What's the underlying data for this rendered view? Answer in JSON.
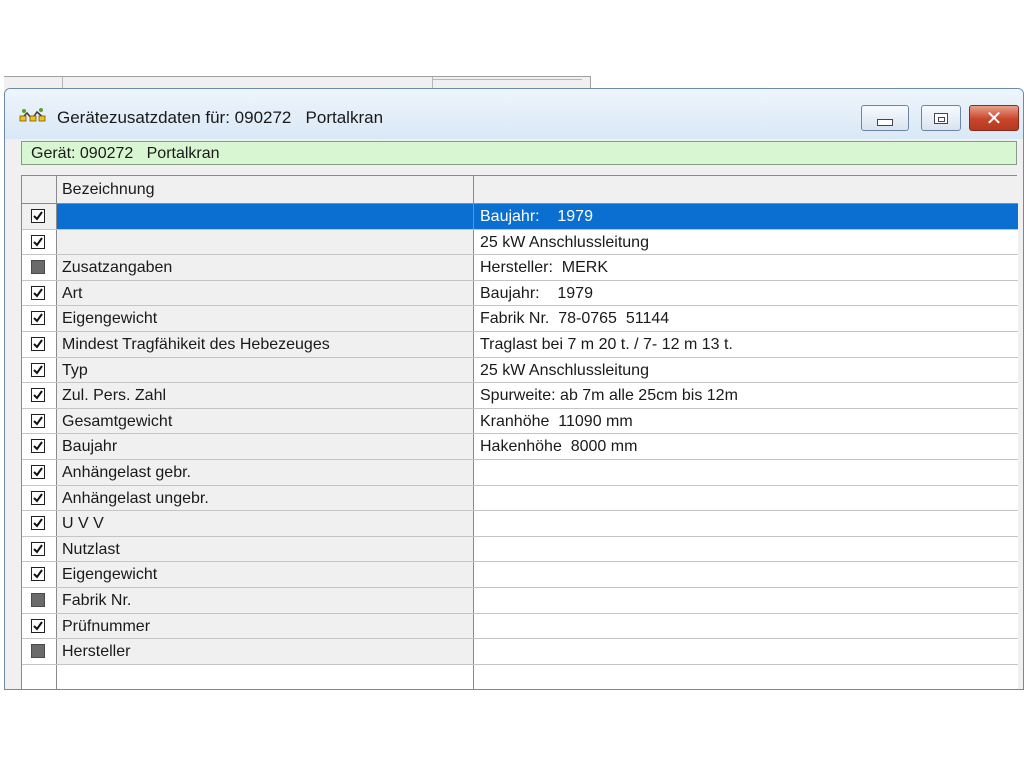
{
  "window": {
    "title": "Gerätezusatzdaten für: 090272   Portalkran",
    "device_label": "Gerät: 090272   Portalkran"
  },
  "grid": {
    "header": {
      "label": "Bezeichnung",
      "value": ""
    },
    "rows": [
      {
        "state": "checked",
        "label": "",
        "value": "Baujahr:    1979",
        "selected": true
      },
      {
        "state": "checked",
        "label": "",
        "value": "25 kW Anschlussleitung"
      },
      {
        "state": "indeterminate",
        "label": "Zusatzangaben",
        "value": "Hersteller:  MERK"
      },
      {
        "state": "checked",
        "label": "Art",
        "value": "Baujahr:    1979"
      },
      {
        "state": "checked",
        "label": "Eigengewicht",
        "value": "Fabrik Nr.  78-0765  51144"
      },
      {
        "state": "checked",
        "label": "Mindest Tragfähikeit des Hebezeuges",
        "value": "Traglast bei 7 m 20 t. / 7- 12 m 13 t."
      },
      {
        "state": "checked",
        "label": "Typ",
        "value": "25 kW Anschlussleitung"
      },
      {
        "state": "checked",
        "label": "Zul. Pers. Zahl",
        "value": "Spurweite: ab 7m alle 25cm bis 12m"
      },
      {
        "state": "checked",
        "label": "Gesamtgewicht",
        "value": "Kranhöhe  11090 mm"
      },
      {
        "state": "checked",
        "label": "Baujahr",
        "value": "Hakenhöhe  8000 mm"
      },
      {
        "state": "checked",
        "label": "Anhängelast gebr.",
        "value": ""
      },
      {
        "state": "checked",
        "label": "Anhängelast ungebr.",
        "value": ""
      },
      {
        "state": "checked",
        "label": "U V V",
        "value": ""
      },
      {
        "state": "checked",
        "label": "Nutzlast",
        "value": ""
      },
      {
        "state": "checked",
        "label": "Eigengewicht",
        "value": ""
      },
      {
        "state": "indeterminate",
        "label": "Fabrik Nr.",
        "value": ""
      },
      {
        "state": "checked",
        "label": "Prüfnummer",
        "value": ""
      },
      {
        "state": "indeterminate",
        "label": "Hersteller",
        "value": ""
      }
    ]
  },
  "colors": {
    "selection": "#0a6fd0",
    "device_box": "#d9f6d2",
    "close_button": "#c8452a"
  }
}
